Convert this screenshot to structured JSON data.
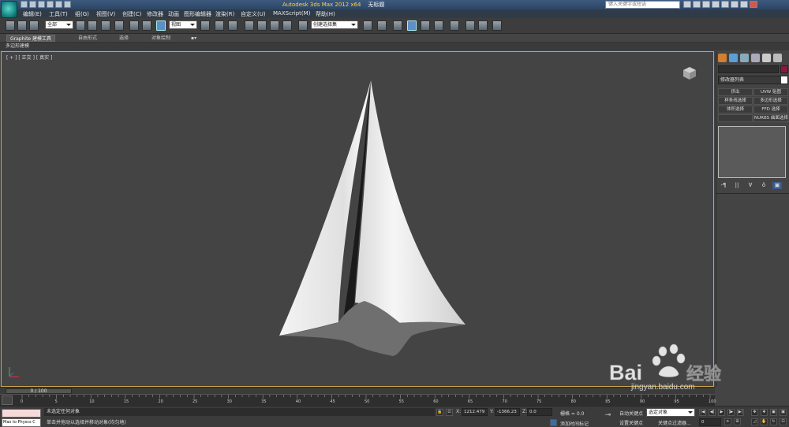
{
  "window": {
    "title_app": "Autodesk 3ds Max  2012 x64",
    "title_doc": "无标题",
    "help_search_placeholder": "键入关键字或短语"
  },
  "menu": [
    "编辑(E)",
    "工具(T)",
    "组(G)",
    "视图(V)",
    "创建(C)",
    "修改器",
    "动画",
    "图形编辑器",
    "渲染(R)",
    "自定义(U)",
    "MAXScript(M)",
    "帮助(H)"
  ],
  "toolbar": {
    "selection_filter": "全部",
    "ref_coord": "视图",
    "named_selection": "创建选择集"
  },
  "ribbon": {
    "tabs": [
      "Graphite 建模工具",
      "自由形式",
      "选择",
      "对象绘制"
    ],
    "sub_label": "多边形建模"
  },
  "viewport": {
    "label": "[ + ] [ 正交 ] [ 真实 ]",
    "view_mode": "正交",
    "shading": "真实"
  },
  "command_panel": {
    "modifier_list": "修改器列表",
    "modifier_buttons": [
      "挤出",
      "UVW 贴图",
      "样条线选择",
      "多边形选择",
      "体积选择",
      "FFD 选择",
      "",
      "NURBS 曲面选择"
    ]
  },
  "timeline": {
    "frame_counter": "0 / 100",
    "ticks": [
      "0",
      "5",
      "10",
      "15",
      "20",
      "25",
      "30",
      "35",
      "40",
      "45",
      "50",
      "55",
      "60",
      "65",
      "70",
      "75",
      "80",
      "85",
      "90",
      "95",
      "100"
    ]
  },
  "status": {
    "maxscript_output": "Max to Physcs C",
    "selection": "未选定任何对象",
    "prompt": "单击并拖动以选择并移动对象(均匀地)",
    "x_label": "X:",
    "x_value": "1212.479",
    "y_label": "Y:",
    "y_value": "-1366.23",
    "z_label": "Z:",
    "z_value": "0.0",
    "grid": "栅格 = 0.0",
    "add_time_tag": "添加时间标记",
    "auto_key": "自动关键点",
    "auto_key_filter": "选定对象",
    "set_key": "设置关键点",
    "key_filters": "关键点过滤器...",
    "current_frame": "0"
  },
  "watermark": {
    "brand": "Bai",
    "brand_cn": "经验",
    "url": "jingyan.baidu.com"
  }
}
